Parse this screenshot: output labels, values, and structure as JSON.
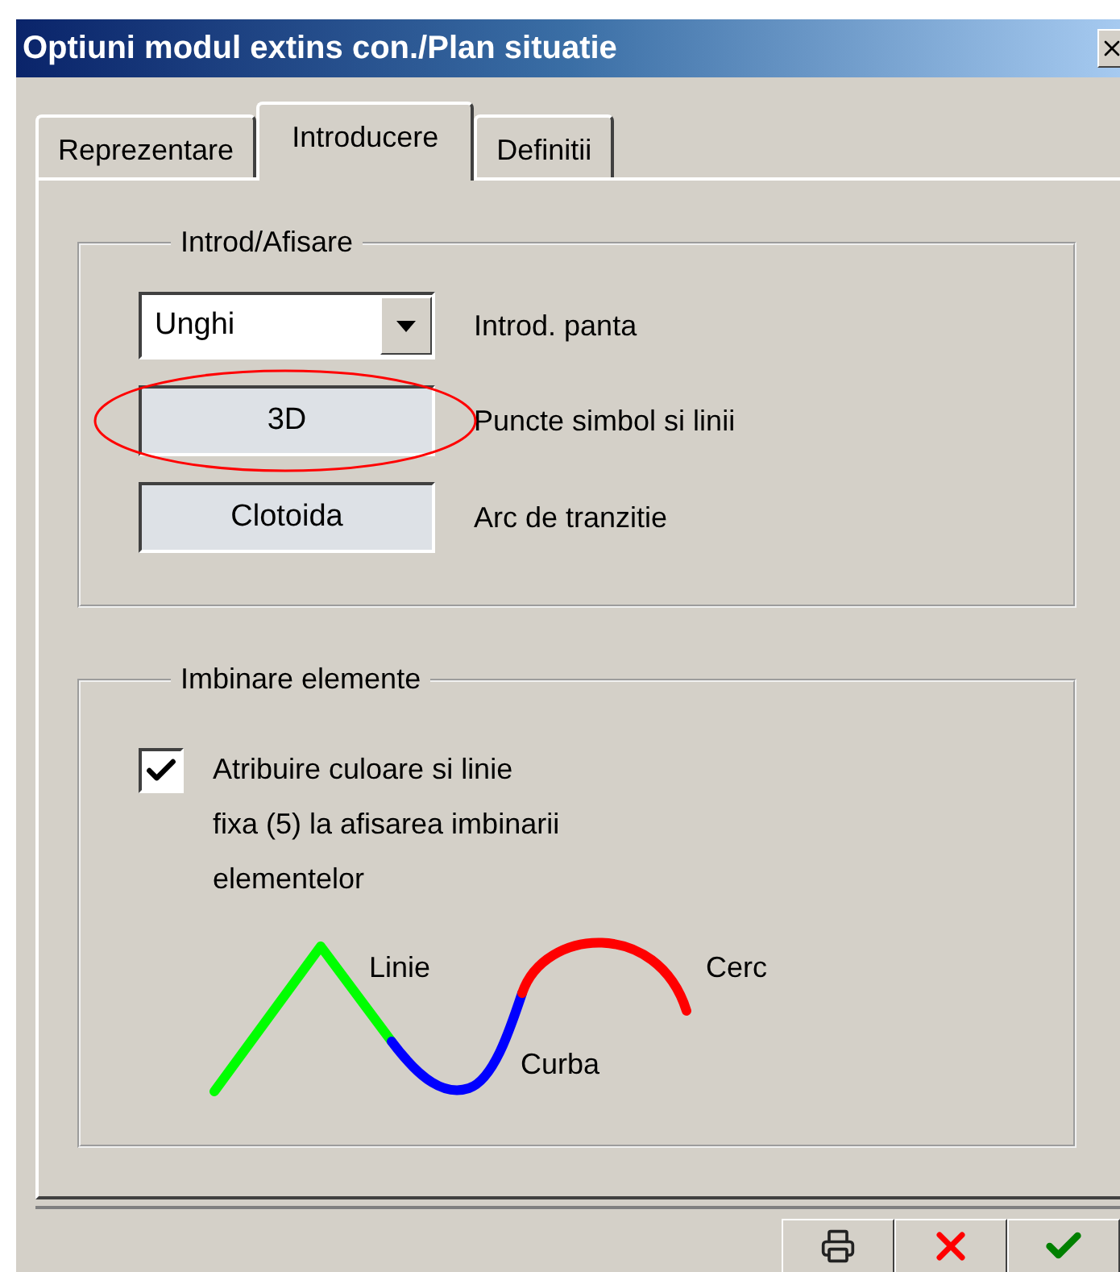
{
  "window": {
    "title": "Optiuni modul extins con./Plan situatie"
  },
  "tabs": [
    {
      "label": "Reprezentare",
      "selected": false
    },
    {
      "label": "Introducere",
      "selected": true
    },
    {
      "label": "Definitii",
      "selected": false
    }
  ],
  "groups": [
    {
      "title": "Introd/Afisare",
      "rows": [
        {
          "kind": "dropdown",
          "value": "Unghi",
          "label": "Introd. panta",
          "highlighted": false
        },
        {
          "kind": "button",
          "value": "3D",
          "label": "Puncte simbol si linii",
          "highlighted": true
        },
        {
          "kind": "button",
          "value": "Clotoida",
          "label": "Arc de tranzitie",
          "highlighted": false
        }
      ]
    },
    {
      "title": "Imbinare elemente",
      "checkbox": {
        "label": "Atribuire culoare si linie\nfixa (5) la afisarea imbinarii\nelementelor",
        "checked": true
      },
      "legend": [
        {
          "label": "Linie",
          "color": "#00ff00"
        },
        {
          "label": "Curba",
          "color": "#0000ff"
        },
        {
          "label": "Cerc",
          "color": "#ff0000"
        }
      ]
    }
  ],
  "footer_buttons": [
    {
      "kind": "print"
    },
    {
      "kind": "cancel"
    },
    {
      "kind": "ok"
    }
  ]
}
